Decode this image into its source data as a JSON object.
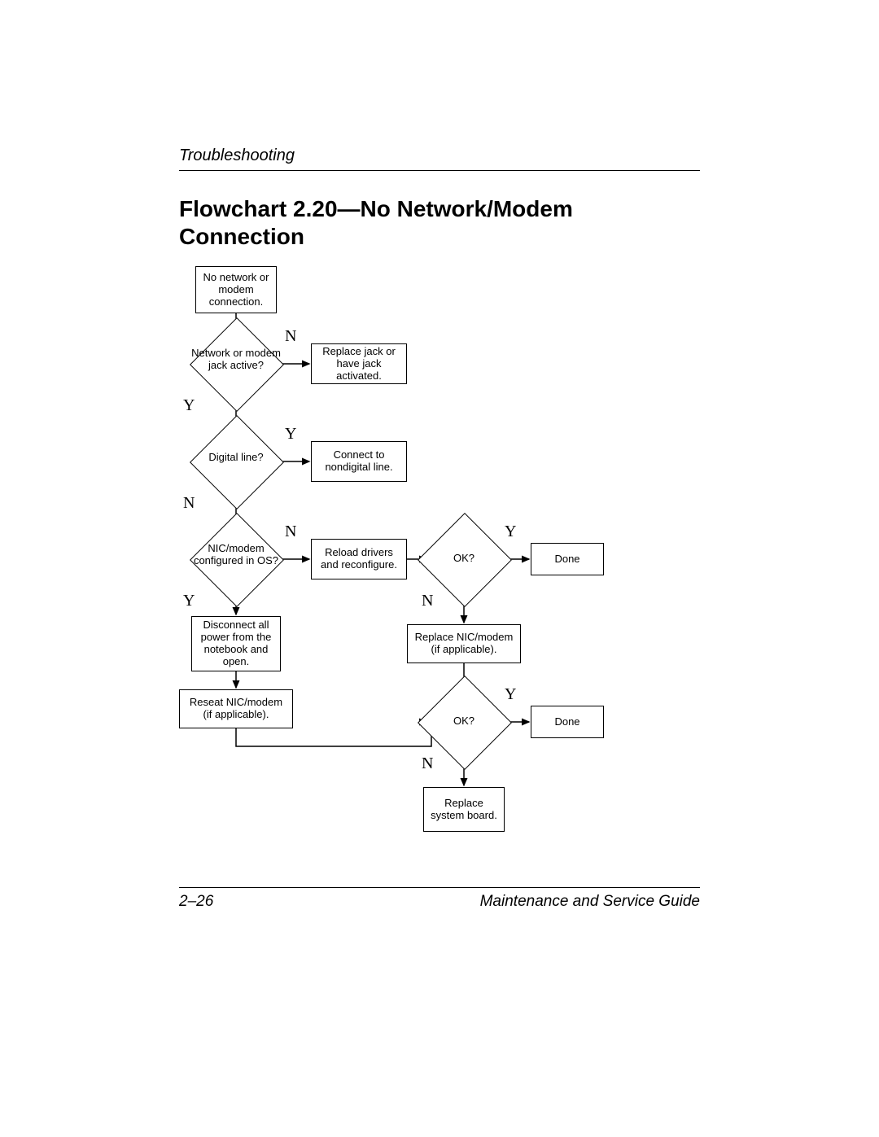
{
  "header": {
    "section": "Troubleshooting"
  },
  "title": "Flowchart 2.20—No Network/Modem Connection",
  "nodes": {
    "start": "No network or modem connection.",
    "jack_active": "Network or modem jack active?",
    "replace_jack": "Replace jack or have jack activated.",
    "digital_line": "Digital line?",
    "connect_nondigital": "Connect to nondigital line.",
    "nic_configured": "NIC/modem configured in OS?",
    "reload_drivers": "Reload drivers and reconfigure.",
    "ok1": "OK?",
    "done1": "Done",
    "disconnect_power": "Disconnect all power from the notebook and open.",
    "reseat_nic": "Reseat NIC/modem (if applicable).",
    "replace_nic": "Replace NIC/modem (if applicable).",
    "ok2": "OK?",
    "done2": "Done",
    "replace_board": "Replace system board."
  },
  "labels": {
    "yes": "Y",
    "no": "N"
  },
  "footer": {
    "page": "2–26",
    "doc": "Maintenance and Service Guide"
  }
}
